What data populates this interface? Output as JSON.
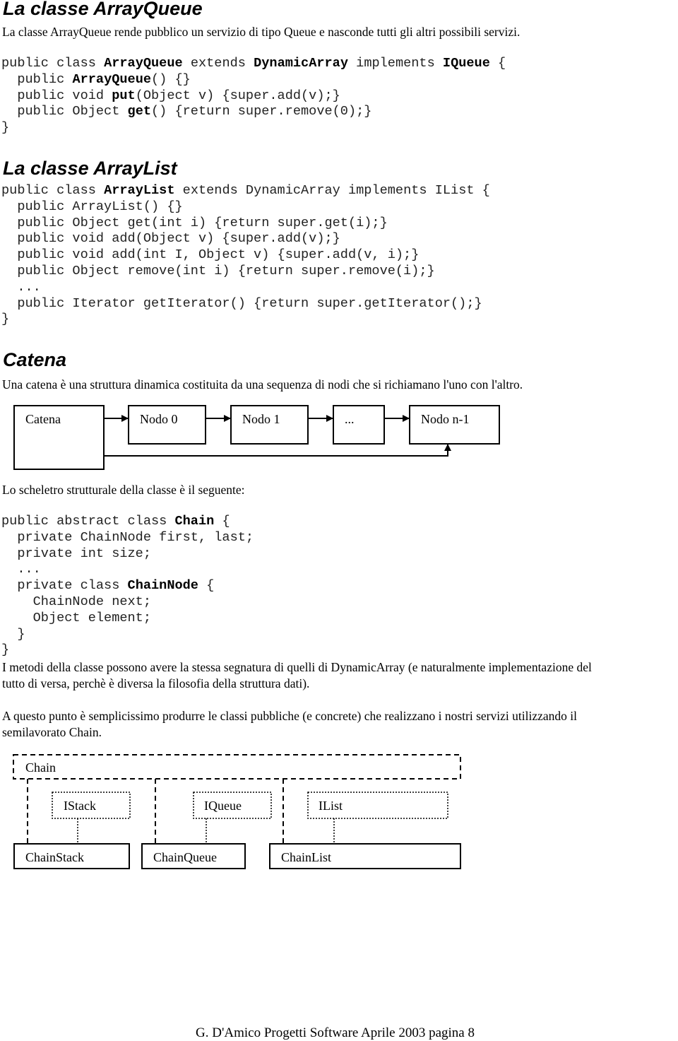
{
  "sections": {
    "arrayqueue": {
      "title": "La classe ArrayQueue",
      "intro": "La classe ArrayQueue rende pubblico un servizio di tipo Queue e nasconde tutti gli altri possibili servizi.",
      "code": [
        [
          [
            "public class ",
            false
          ],
          [
            "ArrayQueue",
            true
          ],
          [
            " extends ",
            false
          ],
          [
            "DynamicArray",
            true
          ],
          [
            " implements ",
            false
          ],
          [
            "IQueue",
            true
          ],
          [
            " {",
            false
          ]
        ],
        [
          [
            "  public ",
            false
          ],
          [
            "ArrayQueue",
            true
          ],
          [
            "() {}",
            false
          ]
        ],
        [
          [
            "  public void ",
            false
          ],
          [
            "put",
            true
          ],
          [
            "(Object v) {super.add(v);}",
            false
          ]
        ],
        [
          [
            "  public Object ",
            false
          ],
          [
            "get",
            true
          ],
          [
            "() {return super.remove(0);}",
            false
          ]
        ],
        [
          [
            "}",
            false
          ]
        ]
      ]
    },
    "arraylist": {
      "title": "La classe ArrayList",
      "code": [
        [
          [
            "public class ",
            false
          ],
          [
            "ArrayList",
            true
          ],
          [
            " extends DynamicArray implements IList {",
            false
          ]
        ],
        [
          [
            "  public ArrayList() {}",
            false
          ]
        ],
        [
          [
            "  public Object get(int i) {return super.get(i);}",
            false
          ]
        ],
        [
          [
            "  public void add(Object v) {super.add(v);}",
            false
          ]
        ],
        [
          [
            "  public void add(int I, Object v) {super.add(v, i);}",
            false
          ]
        ],
        [
          [
            "  public Object remove(int i) {return super.remove(i);}",
            false
          ]
        ],
        [
          [
            "  ...",
            false
          ]
        ],
        [
          [
            "  public Iterator getIterator() {return super.getIterator();}",
            false
          ]
        ],
        [
          [
            "}",
            false
          ]
        ]
      ]
    },
    "catena": {
      "title": "Catena",
      "intro": "Una catena è una struttura dinamica costituita da una sequenza di nodi che si richiamano l'uno con l'altro.",
      "diagram": {
        "catena_label": "Catena",
        "nodes": [
          "Nodo 0",
          "Nodo 1",
          "...",
          "Nodo n-1"
        ]
      },
      "skeleton_intro": "Lo scheletro strutturale della classe è il seguente:",
      "code": [
        [
          [
            "public abstract class ",
            false
          ],
          [
            "Chain",
            true
          ],
          [
            " {",
            false
          ]
        ],
        [
          [
            "  private ChainNode first, last;",
            false
          ]
        ],
        [
          [
            "  private int size;",
            false
          ]
        ],
        [
          [
            "  ...",
            false
          ]
        ],
        [
          [
            "  private class ",
            false
          ],
          [
            "ChainNode",
            true
          ],
          [
            " {",
            false
          ]
        ],
        [
          [
            "    ChainNode next;",
            false
          ]
        ],
        [
          [
            "    Object element;",
            false
          ]
        ],
        [
          [
            "  }",
            false
          ]
        ],
        [
          [
            "}",
            false
          ]
        ]
      ],
      "para1_line1": "I metodi della classe possono avere la stessa segnatura di quelli di DynamicArray (e naturalmente implementazione del",
      "para1_line2": "tutto di versa, perchè è diversa la filosofia della struttura dati).",
      "para2_line1": "A questo punto è semplicissimo produrre le classi pubbliche (e concrete) che realizzano i nostri servizi utilizzando il",
      "para2_line2": "semilavorato Chain."
    },
    "hierarchy": {
      "base": "Chain",
      "interfaces": [
        "IStack",
        "IQueue",
        "IList"
      ],
      "classes": [
        "ChainStack",
        "ChainQueue",
        "ChainList"
      ]
    }
  },
  "footer": "G. D'Amico Progetti Software Aprile 2003 pagina 8"
}
